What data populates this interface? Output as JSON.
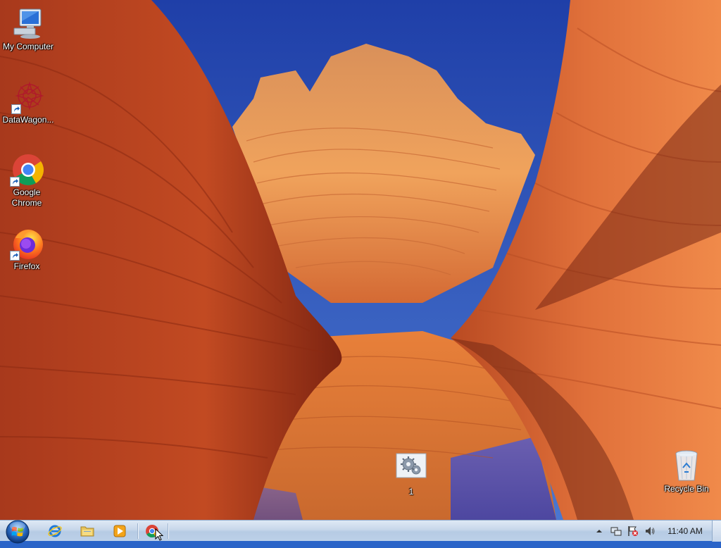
{
  "desktop": {
    "icons": [
      {
        "label": "My Computer",
        "icon": "computer-icon"
      },
      {
        "label": "DataWagon...",
        "icon": "datawagon-icon",
        "shortcut": true
      },
      {
        "label": "Google Chrome",
        "icon": "chrome-icon",
        "shortcut": true
      },
      {
        "label": "Firefox",
        "icon": "firefox-icon",
        "shortcut": true
      },
      {
        "label": "1",
        "icon": "settings-gear-icon"
      },
      {
        "label": "Recycle Bin",
        "icon": "recycle-bin-icon"
      }
    ]
  },
  "taskbar": {
    "start_icon": "windows-start-orb",
    "pinned": [
      {
        "name": "Internet Explorer",
        "icon": "internet-explorer-icon"
      },
      {
        "name": "Windows Explorer",
        "icon": "folder-icon"
      },
      {
        "name": "Windows Media Player",
        "icon": "media-player-icon"
      },
      {
        "name": "Google Chrome",
        "icon": "chrome-icon",
        "active": true
      }
    ],
    "tray": {
      "icons": [
        "show-hidden-icons-chevron",
        "network-icon",
        "action-center-flag-icon",
        "volume-icon"
      ],
      "clock": "11:40 AM"
    }
  },
  "colors": {
    "sky": "#2f4fb7",
    "rock_orange": "#e8743a",
    "rock_dark": "#8f2a14",
    "taskbar": "#c7d7ea"
  }
}
